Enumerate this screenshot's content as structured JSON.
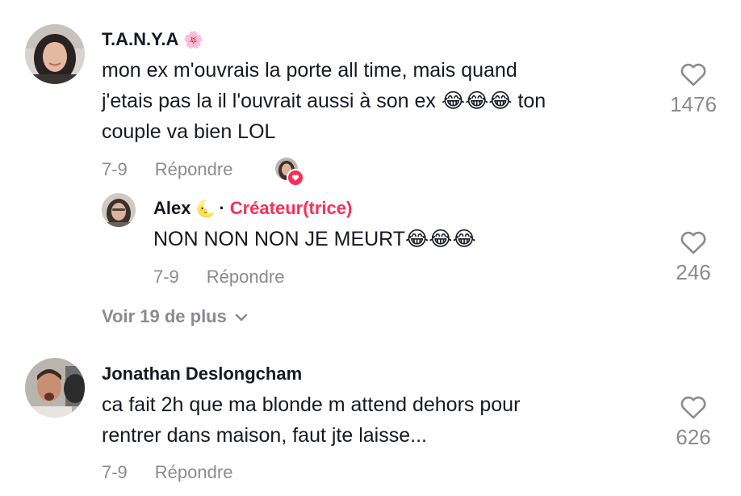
{
  "comments": [
    {
      "username": "T.A.N.Y.A",
      "badge_emoji": "🌸",
      "text_lines": [
        "mon ex m'ouvrais la porte all time, mais quand",
        "j'etais pas la il l'ouvrait aussi à son ex 😂😂😂 ton",
        "couple va bien LOL"
      ],
      "date": "7-9",
      "reply_label": "Répondre",
      "likes": "1476",
      "creator_liked": true,
      "replies": [
        {
          "username": "Alex",
          "badge_emoji": "🌜",
          "separator": "·",
          "creator_label": "Créateur(trice)",
          "text": "NON NON NON JE MEURT😂😂😂",
          "date": "7-9",
          "reply_label": "Répondre",
          "likes": "246"
        }
      ],
      "view_more_label": "Voir 19 de plus"
    },
    {
      "username": "Jonathan Deslongcham",
      "text_lines": [
        "ca fait 2h que ma blonde m attend dehors pour",
        "rentrer dans maison, faut jte laisse..."
      ],
      "date": "7-9",
      "reply_label": "Répondre",
      "likes": "626"
    }
  ],
  "colors": {
    "text": "#161823",
    "muted": "#8a8b91",
    "creator_accent": "#fe2c55"
  },
  "icons": {
    "like": "heart-outline-icon",
    "expand": "chevron-down-icon",
    "creator_liked": "heart-badge-icon"
  }
}
